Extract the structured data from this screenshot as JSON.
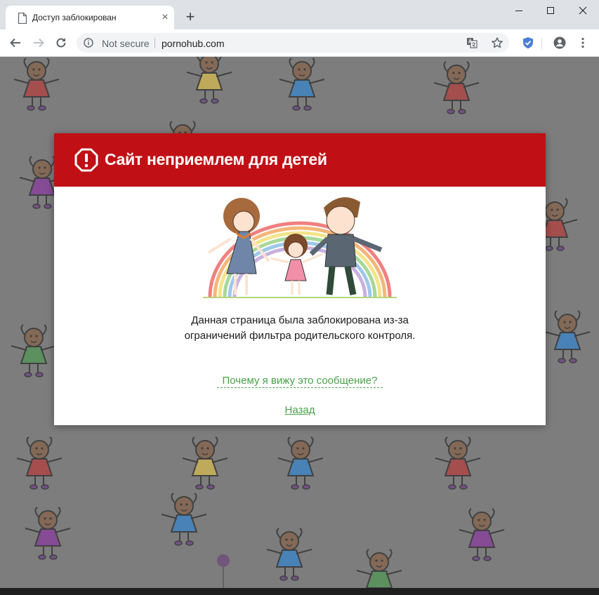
{
  "tab": {
    "title": "Доступ заблокирован",
    "close_symbol": "×",
    "new_tab_symbol": "+"
  },
  "window_controls": {
    "minimize_icon": "minimize-icon",
    "maximize_icon": "maximize-icon",
    "close_icon": "close-icon"
  },
  "omnibox": {
    "security_label": "Not secure",
    "url": "pornohub.com"
  },
  "modal": {
    "title": "Сайт неприемлем для детей",
    "message_line1": "Данная страница была заблокирована из-за",
    "message_line2": "ограничений фильтра родительского контроля.",
    "why_link": "Почему я вижу это сообщение?",
    "back_link": "Назад"
  },
  "colors": {
    "header_red": "#c01015",
    "link_green": "#4aa04a",
    "backdrop_gray": "#7d7d7d"
  }
}
